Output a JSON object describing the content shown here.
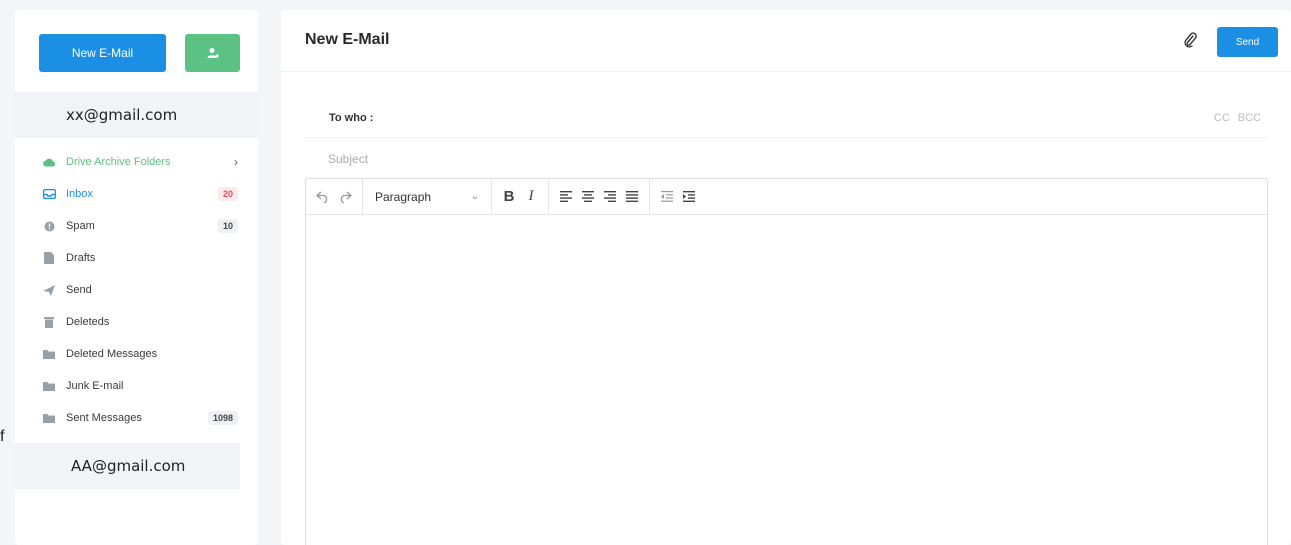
{
  "edge_glyph": "f",
  "sidebar": {
    "new_email_label": "New E-Mail",
    "contact_icon": "user-add-icon",
    "account_primary": "xx@gmail.com",
    "account_secondary": "AA@gmail.com",
    "folders": [
      {
        "label": "Drive Archive Folders",
        "icon": "cloud-icon",
        "badge": "",
        "chevron": "›"
      },
      {
        "label": "Inbox",
        "icon": "inbox-icon",
        "badge": "20"
      },
      {
        "label": "Spam",
        "icon": "spam-icon",
        "badge": "10"
      },
      {
        "label": "Drafts",
        "icon": "draft-icon",
        "badge": ""
      },
      {
        "label": "Send",
        "icon": "send-icon",
        "badge": ""
      },
      {
        "label": "Deleteds",
        "icon": "trash-icon",
        "badge": ""
      },
      {
        "label": "Deleted Messages",
        "icon": "folder-icon",
        "badge": ""
      },
      {
        "label": "Junk E-mail",
        "icon": "folder-icon",
        "badge": ""
      },
      {
        "label": "Sent Messages",
        "icon": "folder-icon",
        "badge": "1098"
      }
    ]
  },
  "compose": {
    "title": "New E-Mail",
    "send_label": "Send",
    "to_label": "To who :",
    "cc_label": "CC",
    "bcc_label": "BCC",
    "subject_placeholder": "Subject",
    "paragraph_label": "Paragraph",
    "bold_label": "B",
    "italic_label": "I"
  },
  "colors": {
    "primary": "#1a8fe3",
    "green": "#5cc283",
    "badge_red": "#e84a5f"
  }
}
